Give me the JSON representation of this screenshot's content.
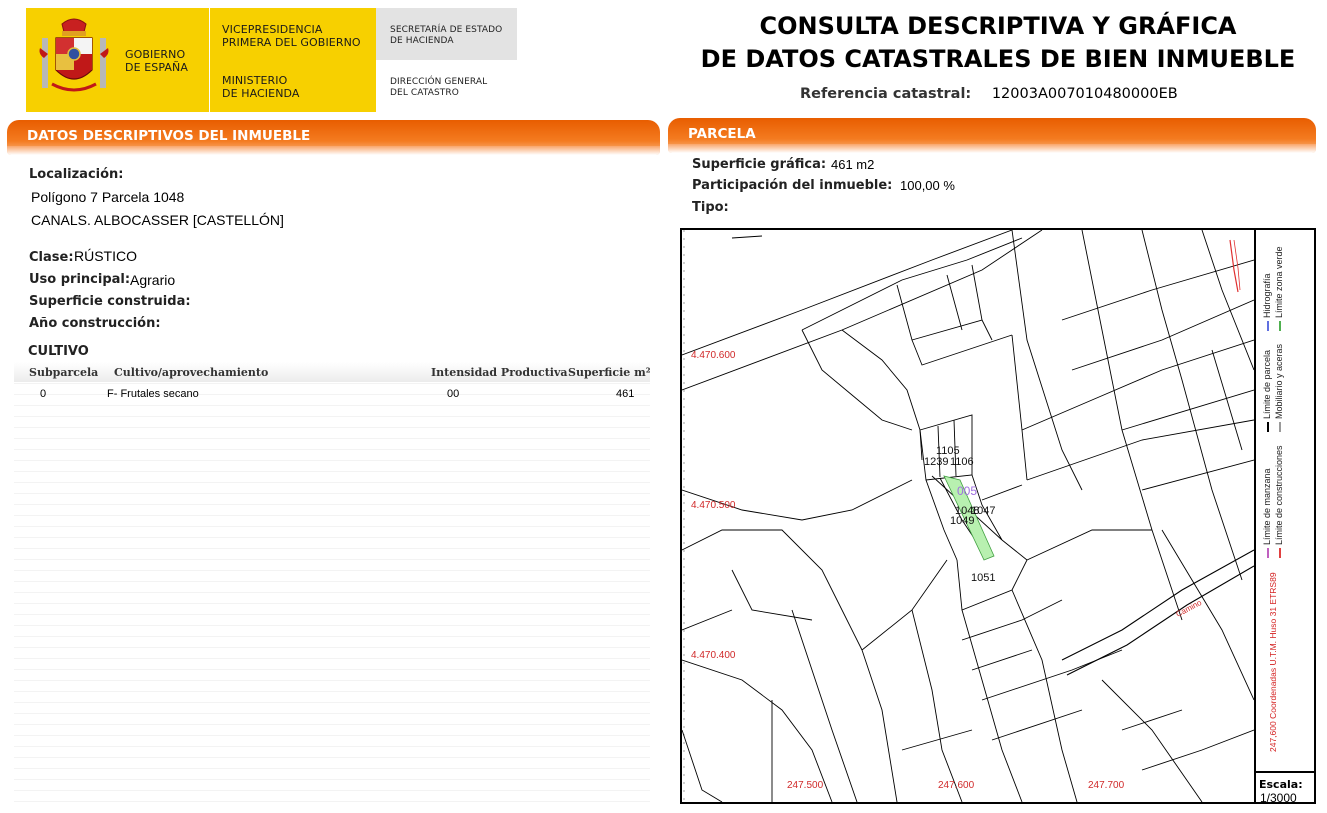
{
  "header": {
    "logo": {
      "gobierno": [
        "GOBIERNO",
        "DE ESPAÑA"
      ],
      "vicepresidencia": [
        "VICEPRESIDENCIA",
        "PRIMERA DEL GOBIERNO"
      ],
      "ministerio": [
        "MINISTERIO",
        "DE HACIENDA"
      ],
      "secretaria": [
        "SECRETARÍA DE ESTADO",
        "DE HACIENDA"
      ],
      "direccion": [
        "DIRECCIÓN GENERAL",
        "DEL CATASTRO"
      ]
    },
    "title_lines": [
      "CONSULTA DESCRIPTIVA Y GRÁFICA",
      "DE DATOS CATASTRALES DE BIEN INMUEBLE"
    ],
    "referencia_label": "Referencia catastral:",
    "referencia_value": "12003A007010480000EB"
  },
  "datos": {
    "section_title": "DATOS DESCRIPTIVOS DEL INMUEBLE",
    "localizacion_label": "Localización:",
    "localizacion_lines": [
      "Polígono 7 Parcela 1048",
      "CANALS. ALBOCASSER [CASTELLÓN]"
    ],
    "clase_label": "Clase:",
    "clase_value": "RÚSTICO",
    "uso_label": "Uso principal:",
    "uso_value": "Agrario",
    "superficie_construida_label": "Superficie construida:",
    "ano_label": "Año construcción:",
    "cultivo": {
      "title": "CULTIVO",
      "headers": [
        "Subparcela",
        "Cultivo/aprovechamiento",
        "Intensidad Productiva",
        "Superficie m²"
      ],
      "rows": [
        [
          "0",
          "F- Frutales secano",
          "00",
          "461"
        ]
      ]
    }
  },
  "parcela": {
    "section_title": "PARCELA",
    "superficie_label": "Superficie gráfica:",
    "superficie_value": "461 m2",
    "participacion_label": "Participación del inmueble:",
    "participacion_value": "100,00 %",
    "tipo_label": "Tipo:",
    "map": {
      "y_ticks": [
        "4.470.600",
        "4.470.500",
        "4.470.400"
      ],
      "x_ticks": [
        "247.500",
        "247.600",
        "247.700"
      ],
      "parcel_labels": [
        "1105",
        "1239",
        "1106",
        "1048",
        "1047",
        "1049",
        "1051",
        "005"
      ],
      "road_label": "Camino",
      "legend": [
        {
          "label": "Límite de manzana",
          "color": "#c060c0"
        },
        {
          "label": "Límite de construcciones",
          "color": "#e04040"
        },
        {
          "label": "Límite de parcela",
          "color": "#000000"
        },
        {
          "label": "Mobiliario y aceras",
          "color": "#9a9a9a"
        },
        {
          "label": "Hidrografía",
          "color": "#6070e0"
        },
        {
          "label": "Límite zona verde",
          "color": "#50b050"
        }
      ],
      "coord_note": "247,600 Coordenadas U.T.M. Huso 31 ETRS89",
      "scale_label": "Escala:",
      "scale_value": "1/3000",
      "highlight_color": "#b8f0b0"
    }
  }
}
